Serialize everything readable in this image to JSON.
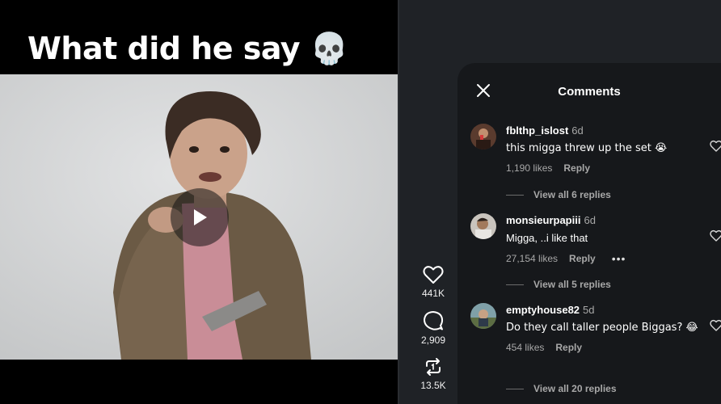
{
  "video": {
    "caption": "What did he say 💀"
  },
  "actions": [
    {
      "icon": "heart-icon",
      "count": "441K"
    },
    {
      "icon": "comment-icon",
      "count": "2,909"
    },
    {
      "icon": "repost-icon",
      "count": "13.5K"
    }
  ],
  "comments_panel": {
    "title": "Comments",
    "comments": [
      {
        "username": "fblthp_islost",
        "age": "6d",
        "text": "this migga threw up the set 😭",
        "likes": "1,190 likes",
        "reply": "Reply",
        "view_replies": "View all 6 replies"
      },
      {
        "username": "monsieurpapiii",
        "age": "6d",
        "text": "Migga, ..i like that",
        "likes": "27,154 likes",
        "reply": "Reply",
        "more": "•••",
        "view_replies": "View all 5 replies"
      },
      {
        "username": "emptyhouse82",
        "age": "5d",
        "text": "Do they call taller people Biggas? 😂",
        "likes": "454 likes",
        "reply": "Reply",
        "view_replies": "View all 20 replies"
      }
    ]
  }
}
